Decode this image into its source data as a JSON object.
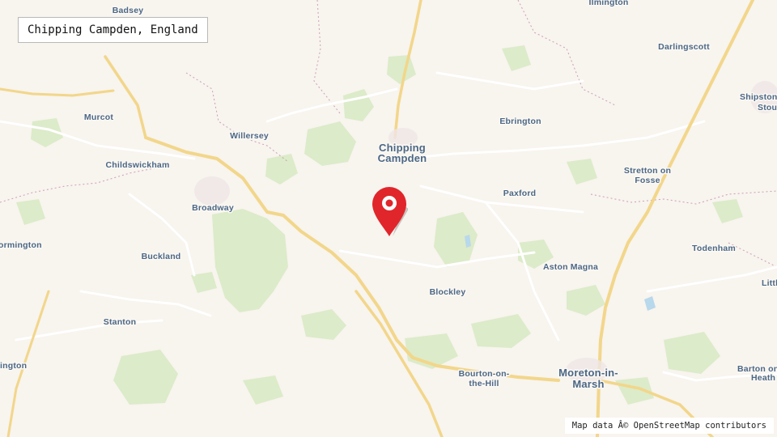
{
  "search": {
    "query": "Chipping Campden, England"
  },
  "marker": {
    "icon": "map-pin-icon",
    "color": "#e0262b"
  },
  "attribution": {
    "text": "Map data Â© OpenStreetMap contributors"
  },
  "colors": {
    "land": "#f8f4ee",
    "woodland": "#dcebc9",
    "major_road": "#f7dc8c",
    "minor_road": "#ffffff",
    "boundary": "#c9a0b8",
    "label": "#4b6786"
  },
  "places": [
    {
      "name": "Badsey",
      "line2": ""
    },
    {
      "name": "Ilmington",
      "line2": ""
    },
    {
      "name": "Darlingscott",
      "line2": ""
    },
    {
      "name": "Shipston-",
      "line2": "Stour"
    },
    {
      "name": "Murcot",
      "line2": ""
    },
    {
      "name": "Willersey",
      "line2": ""
    },
    {
      "name": "Chipping",
      "line2": "Campden"
    },
    {
      "name": "Ebrington",
      "line2": ""
    },
    {
      "name": "Childswickham",
      "line2": ""
    },
    {
      "name": "Stretton on",
      "line2": "Fosse"
    },
    {
      "name": "Broadway",
      "line2": ""
    },
    {
      "name": "Paxford",
      "line2": ""
    },
    {
      "name": "ormington",
      "line2": ""
    },
    {
      "name": "Todenham",
      "line2": ""
    },
    {
      "name": "Buckland",
      "line2": ""
    },
    {
      "name": "Aston Magna",
      "line2": ""
    },
    {
      "name": "Blockley",
      "line2": ""
    },
    {
      "name": "Littl",
      "line2": ""
    },
    {
      "name": "Stanton",
      "line2": ""
    },
    {
      "name": "ington",
      "line2": ""
    },
    {
      "name": "Bourton-on-",
      "line2": "the-Hill"
    },
    {
      "name": "Moreton-in-",
      "line2": "Marsh"
    },
    {
      "name": "Barton on",
      "line2": "Heath"
    }
  ]
}
